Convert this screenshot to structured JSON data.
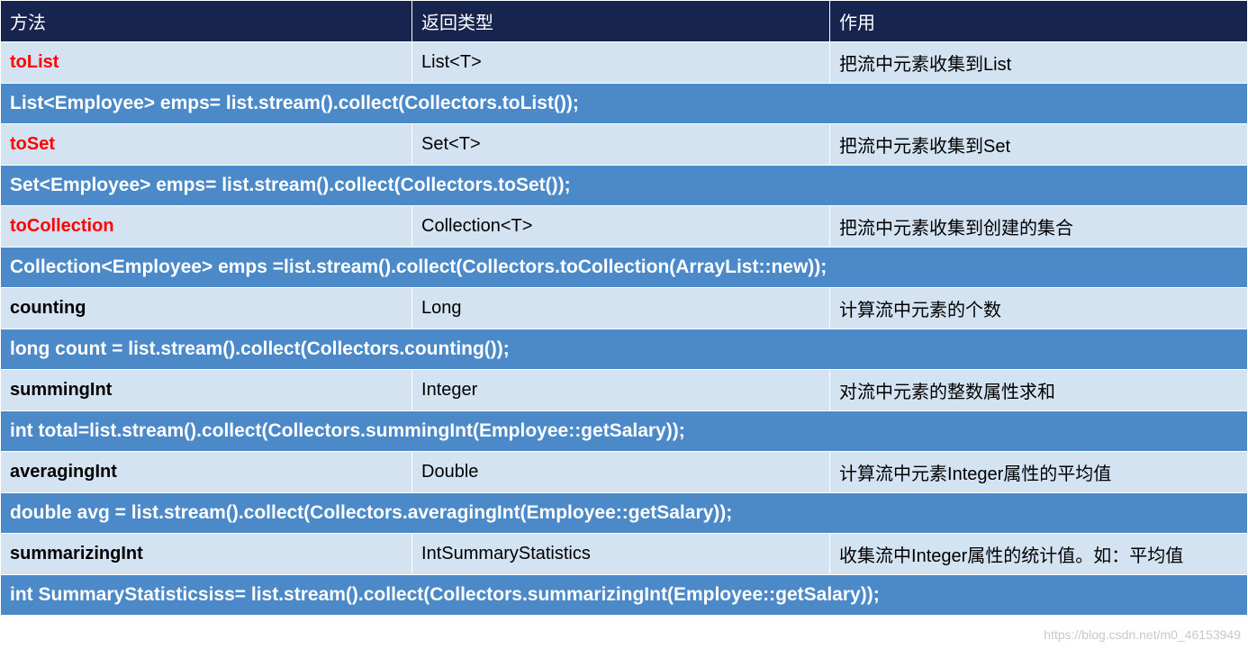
{
  "headers": {
    "method": "方法",
    "returnType": "返回类型",
    "desc": "作用"
  },
  "rows": [
    {
      "kind": "method",
      "red": true,
      "method": "toList",
      "returnType": "List<T>",
      "desc": "把流中元素收集到List"
    },
    {
      "kind": "example",
      "code": "List<Employee> emps= list.stream().collect(Collectors.toList());"
    },
    {
      "kind": "method",
      "red": true,
      "method": "toSet",
      "returnType": "Set<T>",
      "desc": "把流中元素收集到Set"
    },
    {
      "kind": "example",
      "code": "Set<Employee> emps= list.stream().collect(Collectors.toSet());"
    },
    {
      "kind": "method",
      "red": true,
      "method": "toCollection",
      "returnType": "Collection<T>",
      "desc": "把流中元素收集到创建的集合"
    },
    {
      "kind": "example",
      "code": "Collection<Employee> emps =list.stream().collect(Collectors.toCollection(ArrayList::new));"
    },
    {
      "kind": "method",
      "red": false,
      "method": "counting",
      "returnType": "Long",
      "desc": "计算流中元素的个数"
    },
    {
      "kind": "example",
      "code": "long count = list.stream().collect(Collectors.counting());"
    },
    {
      "kind": "method",
      "red": false,
      "method": "summingInt",
      "returnType": "Integer",
      "desc": "对流中元素的整数属性求和"
    },
    {
      "kind": "example",
      "code": "int total=list.stream().collect(Collectors.summingInt(Employee::getSalary));"
    },
    {
      "kind": "method",
      "red": false,
      "method": "averagingInt",
      "returnType": "Double",
      "desc": "计算流中元素Integer属性的平均值"
    },
    {
      "kind": "example",
      "code": "double avg = list.stream().collect(Collectors.averagingInt(Employee::getSalary));"
    },
    {
      "kind": "method",
      "red": false,
      "method": "summarizingInt",
      "returnType": "IntSummaryStatistics",
      "desc": "收集流中Integer属性的统计值。如：平均值"
    },
    {
      "kind": "example",
      "code": "int SummaryStatisticsiss= list.stream().collect(Collectors.summarizingInt(Employee::getSalary));"
    }
  ],
  "watermark": "https://blog.csdn.net/m0_46153949"
}
